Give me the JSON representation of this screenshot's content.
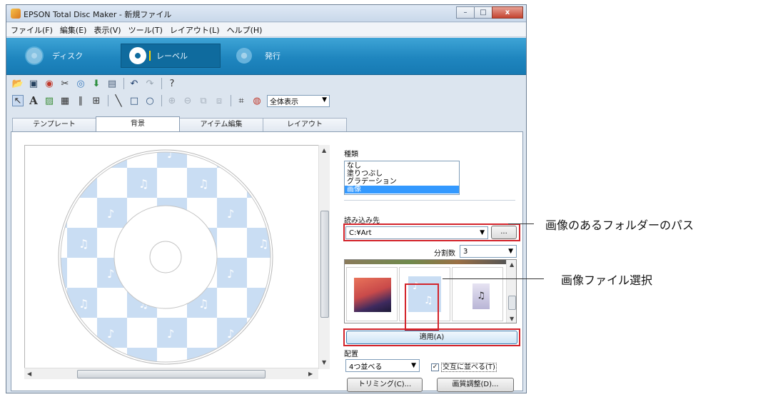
{
  "window": {
    "title": "EPSON Total Disc Maker - 新規ファイル",
    "controls": {
      "minimize": "–",
      "maximize": "□",
      "close": "x"
    }
  },
  "menu": [
    "ファイル(F)",
    "編集(E)",
    "表示(V)",
    "ツール(T)",
    "レイアウト(L)",
    "ヘルプ(H)"
  ],
  "modes": {
    "disc": "ディスク",
    "label": "レーベル",
    "publish": "発行"
  },
  "toolbar": {
    "row1_icons": [
      "open-icon",
      "save-icon",
      "print-icon",
      "wizard-icon",
      "disc-icon",
      "import-icon",
      "export-icon",
      "undo-icon",
      "redo-icon",
      "help-icon"
    ],
    "row2_icons": [
      "pointer-icon",
      "text-icon",
      "image-icon",
      "grid-icon",
      "barcode-icon",
      "tree-icon",
      "line-icon",
      "rect-icon",
      "ellipse-icon",
      "front-icon",
      "back-icon",
      "group-icon",
      "ungroup-icon",
      "crop-icon",
      "color-icon"
    ],
    "view_select": "全体表示"
  },
  "tabs": [
    "テンプレート",
    "背景",
    "アイテム編集",
    "レイアウト"
  ],
  "active_tab": "背景",
  "background": {
    "type_label": "種類",
    "type_options": [
      "なし",
      "塗りつぶし",
      "グラデーション",
      "画像"
    ],
    "type_selected": "画像",
    "source_label": "読み込み先",
    "source_path": "C:¥Art",
    "browse_label": "...",
    "divisions_label": "分割数",
    "divisions_value": "3",
    "apply_label": "適用(A)",
    "placement_label": "配置",
    "placement_value": "4つ並べる",
    "alternate_label": "交互に並べる(T)",
    "alternate_checked": true,
    "trim_label": "トリミング(C)...",
    "quality_label": "画質調整(D)..."
  },
  "callouts": {
    "folder_path": "画像のあるフォルダーのパス",
    "file_select": "画像ファイル選択"
  },
  "colors": {
    "accent": "#1f86bf",
    "highlight": "#d3232a",
    "tile": "#c9ddf3"
  }
}
